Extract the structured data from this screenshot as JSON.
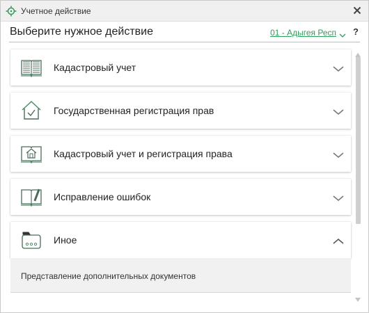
{
  "window": {
    "title": "Учетное действие",
    "title_icon": "crosshair-target-icon",
    "close_icon": "close-icon"
  },
  "header": {
    "title": "Выберите нужное действие",
    "region": "01 - Адыгея Респ",
    "help": "?"
  },
  "colors": {
    "accent": "#2e9e5b",
    "icon_stroke": "#4b8f6a"
  },
  "actions": [
    {
      "label": "Кадастровый учет",
      "icon": "open-book-icon",
      "expanded": false
    },
    {
      "label": "Государственная регистрация прав",
      "icon": "house-check-icon",
      "expanded": false
    },
    {
      "label": "Кадастровый учет и регистрация права",
      "icon": "book-house-icon",
      "expanded": false
    },
    {
      "label": "Исправление ошибок",
      "icon": "book-pen-icon",
      "expanded": false
    },
    {
      "label": "Иное",
      "icon": "folder-dots-icon",
      "expanded": true
    }
  ],
  "expanded_items": [
    "Представление дополнительных документов"
  ]
}
